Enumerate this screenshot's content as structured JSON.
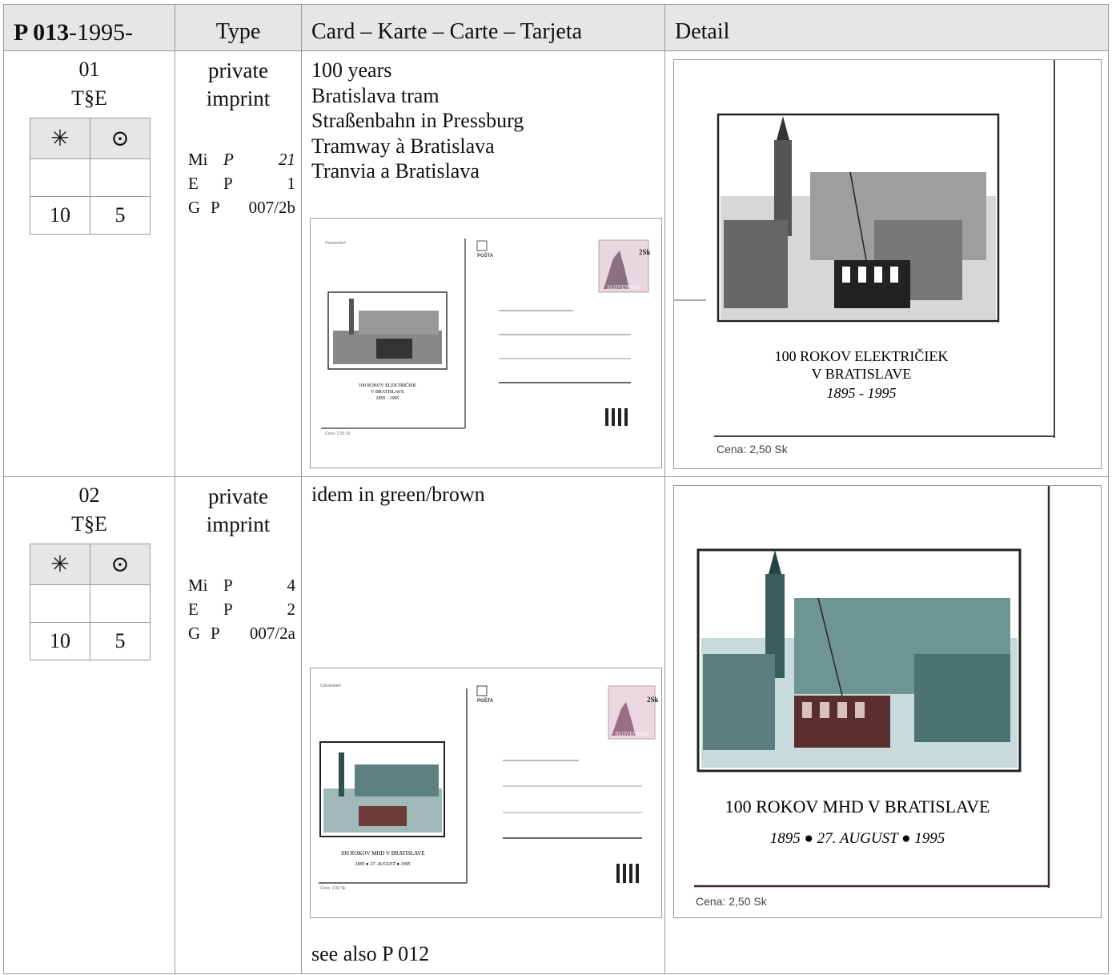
{
  "header": {
    "id_bold": "P 013",
    "id_rest": "-1995-",
    "type": "Type",
    "card": "Card – Karte – Carte – Tarjeta",
    "detail": "Detail"
  },
  "legend": {
    "mint_symbol": "✳",
    "used_symbol": "⊙"
  },
  "rows": [
    {
      "number": "01",
      "code": "T§E",
      "mint_value": "",
      "used_value": "",
      "mint_price": "10",
      "used_price": "5",
      "type_line1": "private",
      "type_line2": "imprint",
      "catalog": [
        {
          "cat": "Mi",
          "prefix": "P",
          "num": "21"
        },
        {
          "cat": "E",
          "prefix": "P",
          "num": "1"
        },
        {
          "cat": "G",
          "prefix": "P",
          "num": "007/2b"
        }
      ],
      "description": [
        "100 years",
        "Bratislava tram",
        "Straßenbahn in Pressburg",
        "Tramway à Bratislava",
        "Tranvia a Bratislava"
      ],
      "card_caption": [
        "100 ROKOV ELEKTRIČIEK",
        "V BRATISLAVE",
        "1895 - 1995"
      ],
      "detail_caption": [
        "100 ROKOV ELEKTRIČIEK",
        "V BRATISLAVE",
        "1895 - 1995"
      ],
      "price_label": "Cena: 2,50 Sk",
      "sender_label": "Odosielateľ:",
      "posta": "POŠTA",
      "stamp_country": "SLOVENSKO",
      "stamp_value": "2Sk",
      "footer": ""
    },
    {
      "number": "02",
      "code": "T§E",
      "mint_value": "",
      "used_value": "",
      "mint_price": "10",
      "used_price": "5",
      "type_line1": "private",
      "type_line2": "imprint",
      "catalog": [
        {
          "cat": "Mi",
          "prefix": "P",
          "num": "4"
        },
        {
          "cat": "E",
          "prefix": "P",
          "num": "2"
        },
        {
          "cat": "G",
          "prefix": "P",
          "num": "007/2a"
        }
      ],
      "description": [
        "idem in green/brown"
      ],
      "card_caption": [
        "100 ROKOV MHD V BRATISLAVE",
        "1895 ● 27. AUGUST ● 1995"
      ],
      "detail_caption": [
        "100 ROKOV MHD V BRATISLAVE",
        "1895 ● 27. AUGUST ● 1995"
      ],
      "price_label": "Cena: 2,50 Sk",
      "sender_label": "Odosielateľ:",
      "posta": "POŠTA",
      "stamp_country": "SLOVENSKO",
      "stamp_value": "2Sk",
      "footer": "see also P 012"
    }
  ]
}
